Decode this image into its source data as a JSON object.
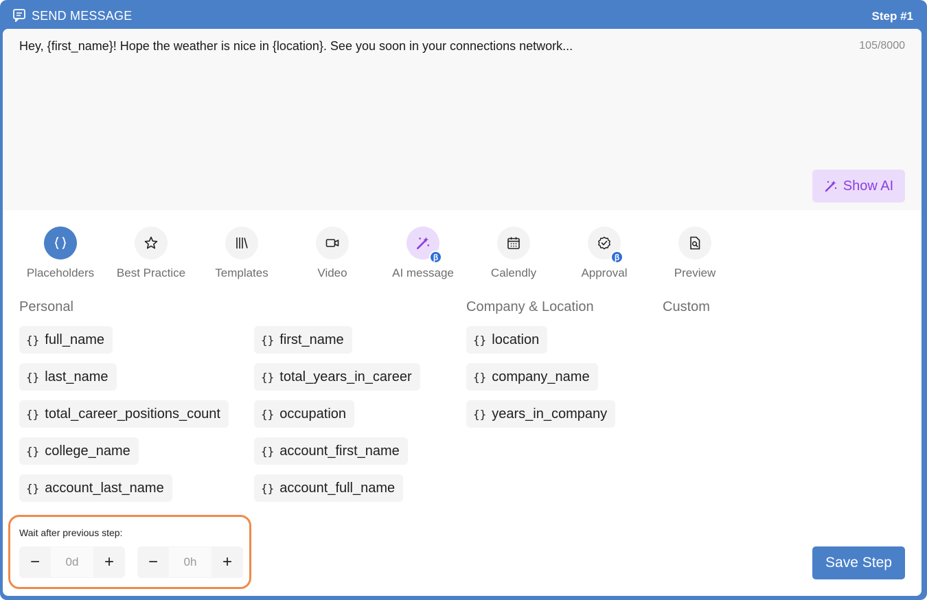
{
  "header": {
    "title": "SEND MESSAGE",
    "step": "Step #1"
  },
  "editor": {
    "message": "Hey, {first_name}! Hope the weather is nice in {location}. See you soon in your connections network...",
    "char_count": "105/8000",
    "show_ai_label": "Show AI"
  },
  "toolbar": [
    {
      "label": "Placeholders",
      "icon": "braces-icon"
    },
    {
      "label": "Best Practice",
      "icon": "star-icon"
    },
    {
      "label": "Templates",
      "icon": "library-icon"
    },
    {
      "label": "Video",
      "icon": "video-icon"
    },
    {
      "label": "AI message",
      "icon": "magic-wand-icon"
    },
    {
      "label": "Calendly",
      "icon": "calendar-icon"
    },
    {
      "label": "Approval",
      "icon": "check-badge-icon"
    },
    {
      "label": "Preview",
      "icon": "file-search-icon"
    }
  ],
  "beta_badge": "β",
  "sections": {
    "personal": "Personal",
    "company": "Company & Location",
    "custom": "Custom"
  },
  "brace_glyph": "{}",
  "placeholders": {
    "personal_col1": [
      "full_name",
      "last_name",
      "total_career_positions_count",
      "college_name",
      "account_last_name"
    ],
    "personal_col2": [
      "first_name",
      "total_years_in_career",
      "occupation",
      "account_first_name",
      "account_full_name"
    ],
    "company": [
      "location",
      "company_name",
      "years_in_company"
    ]
  },
  "wait": {
    "label": "Wait after previous step:",
    "days": "0d",
    "hours": "0h",
    "minus": "−",
    "plus": "+"
  },
  "save_label": "Save Step",
  "colors": {
    "brand": "#4a80c8",
    "ai_purple": "#8a3fe0",
    "highlight": "#ef8a4a"
  }
}
